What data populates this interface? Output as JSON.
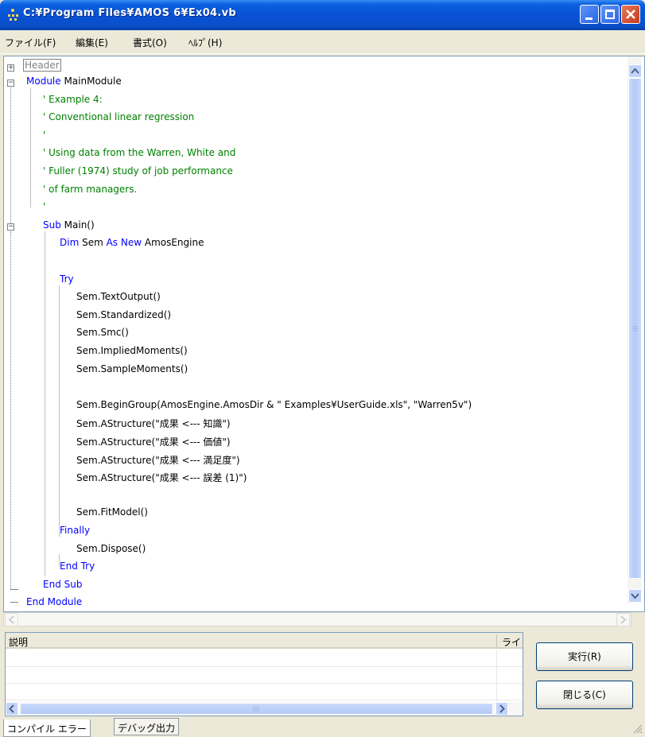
{
  "window": {
    "title": "C:¥Program Files¥AMOS 6¥Ex04.vb"
  },
  "menu": [
    "ファイル(F)",
    "編集(E)",
    "書式(O)",
    "ﾍﾙﾌﾟ(H)"
  ],
  "editor": {
    "header_label": "Header",
    "lines": [
      {
        "seg": [
          [
            "kw",
            "Module"
          ],
          [
            "tx",
            " MainModule"
          ]
        ]
      },
      {
        "seg": [
          [
            "cm",
            "' Example 4:"
          ]
        ]
      },
      {
        "seg": [
          [
            "cm",
            "' Conventional linear regression"
          ]
        ]
      },
      {
        "seg": [
          [
            "cm",
            "'"
          ]
        ]
      },
      {
        "seg": [
          [
            "cm",
            "' Using data from the Warren, White and"
          ]
        ]
      },
      {
        "seg": [
          [
            "cm",
            "' Fuller (1974) study of job performance"
          ]
        ]
      },
      {
        "seg": [
          [
            "cm",
            "' of farm managers."
          ]
        ]
      },
      {
        "seg": [
          [
            "cm",
            "'"
          ]
        ]
      },
      {
        "seg": [
          [
            "kw",
            "Sub"
          ],
          [
            "tx",
            " Main()"
          ]
        ]
      },
      {
        "seg": [
          [
            "kw",
            "Dim"
          ],
          [
            "tx",
            " Sem "
          ],
          [
            "kw",
            "As New"
          ],
          [
            "tx",
            " AmosEngine"
          ]
        ]
      },
      {
        "seg": []
      },
      {
        "seg": [
          [
            "kw",
            "Try"
          ]
        ]
      },
      {
        "seg": [
          [
            "tx",
            "Sem.TextOutput()"
          ]
        ]
      },
      {
        "seg": [
          [
            "tx",
            "Sem.Standardized()"
          ]
        ]
      },
      {
        "seg": [
          [
            "tx",
            "Sem.Smc()"
          ]
        ]
      },
      {
        "seg": [
          [
            "tx",
            "Sem.ImpliedMoments()"
          ]
        ]
      },
      {
        "seg": [
          [
            "tx",
            "Sem.SampleMoments()"
          ]
        ]
      },
      {
        "seg": []
      },
      {
        "seg": [
          [
            "tx",
            "Sem.BeginGroup(AmosEngine.AmosDir & \" Examples¥UserGuide.xls\", \"Warren5v\")"
          ]
        ]
      },
      {
        "seg": [
          [
            "tx",
            "Sem.AStructure(\"成果 <--- 知識\")"
          ]
        ]
      },
      {
        "seg": [
          [
            "tx",
            "Sem.AStructure(\"成果 <--- 価値\")"
          ]
        ]
      },
      {
        "seg": [
          [
            "tx",
            "Sem.AStructure(\"成果 <--- 満足度\")"
          ]
        ]
      },
      {
        "seg": [
          [
            "tx",
            "Sem.AStructure(\"成果 <--- 誤差 (1)\")"
          ]
        ]
      },
      {
        "seg": []
      },
      {
        "seg": [
          [
            "tx",
            "Sem.FitModel()"
          ]
        ]
      },
      {
        "seg": [
          [
            "kw",
            "Finally"
          ]
        ]
      },
      {
        "seg": [
          [
            "tx",
            "Sem.Dispose()"
          ]
        ]
      },
      {
        "seg": [
          [
            "kw",
            "End Try"
          ]
        ]
      },
      {
        "seg": [
          [
            "kw",
            "End Sub"
          ]
        ]
      },
      {
        "seg": [
          [
            "kw",
            "End Module"
          ]
        ]
      }
    ]
  },
  "output_panel": {
    "col_description": "説明",
    "col_line": "ライ"
  },
  "buttons": {
    "run": "実行(R)",
    "close": "閉じる(C)"
  },
  "tabs": [
    "コンパイル エラー",
    "デバッグ出力"
  ]
}
